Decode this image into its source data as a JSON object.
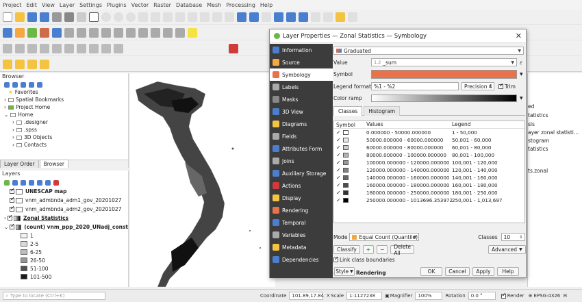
{
  "menu": [
    "Project",
    "Edit",
    "View",
    "Layer",
    "Settings",
    "Plugins",
    "Vector",
    "Raster",
    "Database",
    "Mesh",
    "Processing",
    "Help"
  ],
  "browser": {
    "title": "Browser",
    "items": [
      "Favorites",
      "Spatial Bookmarks",
      "Project Home",
      "Home",
      ".designer",
      ".spss",
      "3D Objects",
      "Contacts"
    ],
    "tabs": [
      "Layer Order",
      "Browser"
    ]
  },
  "layers": {
    "title": "Layers",
    "items": [
      "UNESCAP map",
      "vnm_admbnda_adm1_gov_20201027",
      "vnm_admbnda_adm2_gov_20201027",
      "Zonal Statistics",
      "(count) vnm_ppp_2020_UNadj_const"
    ],
    "legend": [
      {
        "label": "1",
        "color": "#f2f2f2"
      },
      {
        "label": "2-5",
        "color": "#d9d9d9"
      },
      {
        "label": "6-25",
        "color": "#bdbdbd"
      },
      {
        "label": "26-50",
        "color": "#969696"
      },
      {
        "label": "51-100",
        "color": "#525252"
      },
      {
        "label": "101-500",
        "color": "#1a1a1a"
      }
    ]
  },
  "right_panel": [
    "ed",
    "tatistics",
    "sis",
    "ayer zonal statisti...",
    "stogram",
    "tatistics",
    "ts.zonal"
  ],
  "status": {
    "locate_placeholder": "Type to locate (Ctrl+K)",
    "coordinate_label": "Coordinate",
    "coordinate": "101.89,17.84",
    "scale_label": "Scale",
    "scale": "1:1127238",
    "magnifier_label": "Magnifier",
    "magnifier": "100%",
    "rotation_label": "Rotation",
    "rotation": "0.0 °",
    "render_label": "Render",
    "crs": "EPSG:4326"
  },
  "dialog": {
    "title": "Layer Properties — Zonal Statistics — Symbology",
    "sidebar": [
      "Information",
      "Source",
      "Symbology",
      "Labels",
      "Masks",
      "3D View",
      "Diagrams",
      "Fields",
      "Attributes Form",
      "Joins",
      "Auxiliary Storage",
      "Actions",
      "Display",
      "Rendering",
      "Temporal",
      "Variables",
      "Metadata",
      "Dependencies"
    ],
    "renderer": "Graduated",
    "value_label": "Value",
    "value": "_sum",
    "value_prefix": "1.2",
    "symbol_label": "Symbol",
    "symbol_color": "#e8734a",
    "legend_format_label": "Legend format",
    "legend_format": "%1 - %2",
    "precision_label": "Precision 4",
    "trim_label": "Trim",
    "color_ramp_label": "Color ramp",
    "tabs": [
      "Classes",
      "Histogram"
    ],
    "columns": [
      "Symbol",
      "Values",
      "Legend"
    ],
    "classes": [
      {
        "values": "0.000000 - 50000.000000",
        "legend": "1 - 50,000",
        "color": "#ffffff"
      },
      {
        "values": "50000.000000 - 60000.000000",
        "legend": "50,001 - 60,000",
        "color": "#e6e6e6"
      },
      {
        "values": "60000.000000 - 80000.000000",
        "legend": "60,001 - 80,000",
        "color": "#cccccc"
      },
      {
        "values": "80000.000000 - 100000.000000",
        "legend": "80,001 - 100,000",
        "color": "#b3b3b3"
      },
      {
        "values": "100000.000000 - 120000.000000",
        "legend": "100,001 - 120,000",
        "color": "#999999"
      },
      {
        "values": "120000.000000 - 140000.000000",
        "legend": "120,001 - 140,000",
        "color": "#808080"
      },
      {
        "values": "140000.000000 - 160000.000000",
        "legend": "140,001 - 160,000",
        "color": "#666666"
      },
      {
        "values": "160000.000000 - 180000.000000",
        "legend": "160,001 - 180,000",
        "color": "#4d4d4d"
      },
      {
        "values": "180000.000000 - 250000.000000",
        "legend": "180,001 - 250,000",
        "color": "#333333"
      },
      {
        "values": "250000.000000 - 1013696.353972",
        "legend": "250,001 - 1,013,697",
        "color": "#000000"
      }
    ],
    "mode_label": "Mode",
    "mode": "Equal Count (Quantile)",
    "classes_label": "Classes",
    "classes_count": "10",
    "classify_label": "Classify",
    "delete_all_label": "Delete All",
    "advanced_label": "Advanced",
    "link_boundaries_label": "Link class boundaries",
    "layer_rendering_label": "Layer Rendering",
    "style_label": "Style",
    "ok_label": "OK",
    "cancel_label": "Cancel",
    "apply_label": "Apply",
    "help_label": "Help"
  }
}
